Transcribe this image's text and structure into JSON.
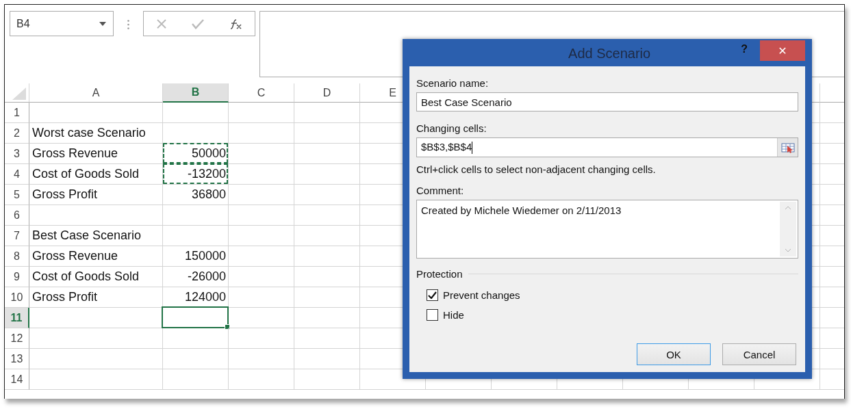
{
  "formula_bar": {
    "name_box": "B4"
  },
  "sheet": {
    "columns": [
      {
        "label": "A",
        "selected": false
      },
      {
        "label": "B",
        "selected": true
      },
      {
        "label": "C",
        "selected": false
      },
      {
        "label": "D",
        "selected": false
      },
      {
        "label": "E",
        "selected": false
      }
    ],
    "rows": [
      {
        "number": "1",
        "selected": false,
        "b_marquee": false,
        "b_active": false
      },
      {
        "number": "2",
        "selected": false,
        "a": "Worst case Scenario",
        "b_marquee": false,
        "b_active": false
      },
      {
        "number": "3",
        "selected": false,
        "a": "Gross Revenue",
        "b": "50000",
        "b_marquee": true,
        "b_active": false
      },
      {
        "number": "4",
        "selected": false,
        "a": "Cost of Goods Sold",
        "b": "-13200",
        "b_marquee": true,
        "b_active": false
      },
      {
        "number": "5",
        "selected": false,
        "a": "Gross Profit",
        "b": "36800",
        "b_marquee": false,
        "b_active": false
      },
      {
        "number": "6",
        "selected": false,
        "b_marquee": false,
        "b_active": false
      },
      {
        "number": "7",
        "selected": false,
        "a": "Best Case Scenario",
        "b_marquee": false,
        "b_active": false
      },
      {
        "number": "8",
        "selected": false,
        "a": "Gross Revenue",
        "b": "150000",
        "b_marquee": false,
        "b_active": false
      },
      {
        "number": "9",
        "selected": false,
        "a": "Cost of Goods Sold",
        "b": "-26000",
        "b_marquee": false,
        "b_active": false
      },
      {
        "number": "10",
        "selected": false,
        "a": "Gross Profit",
        "b": "124000",
        "b_marquee": false,
        "b_active": false
      },
      {
        "number": "11",
        "selected": true,
        "b_marquee": false,
        "b_active": true
      },
      {
        "number": "12",
        "selected": false,
        "b_marquee": false,
        "b_active": false
      },
      {
        "number": "13",
        "selected": false,
        "b_marquee": false,
        "b_active": false
      },
      {
        "number": "14",
        "selected": false,
        "b_marquee": false,
        "b_active": false
      }
    ]
  },
  "dialog": {
    "title": "Add Scenario",
    "help": "?",
    "close": "✕",
    "scenario_name": {
      "label": "Scenario name:",
      "value": "Best Case Scenario"
    },
    "changing_cells": {
      "label": "Changing cells:",
      "value": "$B$3,$B$4"
    },
    "hint": "Ctrl+click cells to select non-adjacent changing cells.",
    "comment": {
      "label": "Comment:",
      "value": "Created by Michele Wiedemer on 2/11/2013"
    },
    "protection": {
      "title": "Protection",
      "options": [
        {
          "label": "Prevent changes",
          "checked": true
        },
        {
          "label": "Hide",
          "checked": false
        }
      ]
    },
    "buttons": [
      {
        "label": "OK",
        "default": true
      },
      {
        "label": "Cancel",
        "default": false
      }
    ]
  }
}
